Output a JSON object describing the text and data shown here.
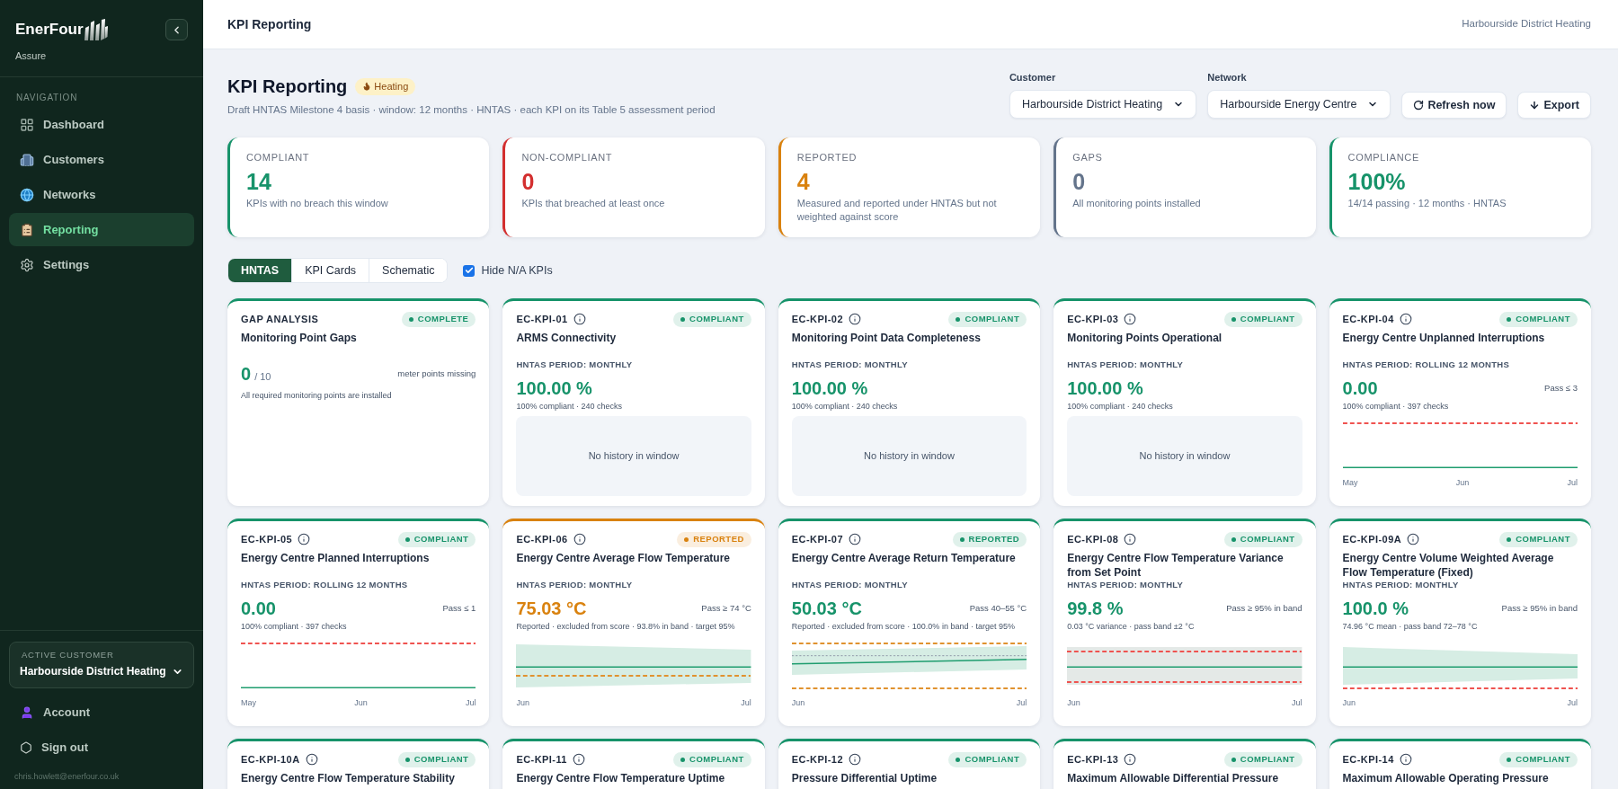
{
  "sidebar": {
    "brand": "EnerFour",
    "product": "Assure",
    "nav_heading": "NAVIGATION",
    "nav_items": [
      {
        "label": "Dashboard",
        "kind": "dashboard",
        "selected": false
      },
      {
        "label": "Customers",
        "kind": "customers",
        "selected": false
      },
      {
        "label": "Networks",
        "kind": "networks",
        "selected": false
      },
      {
        "label": "Reporting",
        "kind": "reporting",
        "selected": true
      },
      {
        "label": "Settings",
        "kind": "settings",
        "selected": false
      }
    ],
    "active_customer": {
      "label": "ACTIVE CUSTOMER",
      "value": "Harbourside District Heating"
    },
    "user_items": [
      {
        "label": "Account",
        "kind": "account"
      },
      {
        "label": "Sign out",
        "kind": "sign_out"
      }
    ],
    "user_email": "chris.howlett@enerfour.co.uk"
  },
  "header": {
    "title": "KPI Reporting",
    "context": "Harbourside District Heating"
  },
  "page": {
    "title": "KPI Reporting",
    "tag": "Heating",
    "subtitle": "Draft HNTAS Milestone 4 basis · window: 12 months · HNTAS · each KPI on its Table 5 assessment period"
  },
  "filters": [
    {
      "label": "Customer",
      "value": "Harbourside District Heating"
    },
    {
      "label": "Network",
      "value": "Harbourside Energy Centre"
    }
  ],
  "actions": [
    {
      "label": "Refresh now",
      "kind": "refresh"
    },
    {
      "label": "Export",
      "kind": "export"
    }
  ],
  "summary_cards": [
    {
      "label": "COMPLIANT",
      "value": "14",
      "description": "KPIs with no breach this window",
      "color": "#17936a"
    },
    {
      "label": "NON-COMPLIANT",
      "value": "0",
      "description": "KPIs that breached at least once",
      "color": "#d32f2f"
    },
    {
      "label": "REPORTED",
      "value": "4",
      "description": "Measured and reported under HNTAS but not weighted against score",
      "color": "#d9820f"
    },
    {
      "label": "GAPS",
      "value": "0",
      "description": "All monitoring points installed",
      "color": "#64748b"
    },
    {
      "label": "COMPLIANCE",
      "value": "100%",
      "description": "14/14 passing · 12 months · HNTAS",
      "color": "#17936a"
    }
  ],
  "view_tabs": [
    {
      "label": "HNTAS",
      "selected": true
    },
    {
      "label": "KPI Cards",
      "selected": false
    },
    {
      "label": "Schematic",
      "selected": false
    }
  ],
  "hide_na": {
    "label": "Hide N/A KPIs",
    "checked": true
  },
  "kpi_cards": [
    {
      "kind": "gap",
      "code": "GAP ANALYSIS",
      "badge": "COMPLETE",
      "color": "#17936a",
      "title": "Monitoring Point Gaps",
      "value": "0",
      "value_total": "/ 10",
      "note": "meter points missing",
      "detail": "All required monitoring points are installed"
    },
    {
      "kind": "kpi",
      "code": "EC-KPI-01",
      "badge": "COMPLIANT",
      "color": "#17936a",
      "title": "ARMS Connectivity",
      "period": "HNTAS PERIOD: MONTHLY",
      "value": "100.00 %",
      "detail": "100% compliant · 240 checks",
      "chart": {
        "kind": "empty",
        "message": "No history in window"
      }
    },
    {
      "kind": "kpi",
      "code": "EC-KPI-02",
      "badge": "COMPLIANT",
      "color": "#17936a",
      "title": "Monitoring Point Data Completeness",
      "period": "HNTAS PERIOD: MONTHLY",
      "value": "100.00 %",
      "detail": "100% compliant · 240 checks",
      "chart": {
        "kind": "empty",
        "message": "No history in window"
      }
    },
    {
      "kind": "kpi",
      "code": "EC-KPI-03",
      "badge": "COMPLIANT",
      "color": "#17936a",
      "title": "Monitoring Points Operational",
      "period": "HNTAS PERIOD: MONTHLY",
      "value": "100.00 %",
      "detail": "100% compliant · 240 checks",
      "chart": {
        "kind": "empty",
        "message": "No history in window"
      }
    },
    {
      "kind": "kpi",
      "code": "EC-KPI-04",
      "badge": "COMPLIANT",
      "color": "#17936a",
      "title": "Energy Centre Unplanned Interruptions",
      "period": "HNTAS PERIOD: ROLLING 12 MONTHS",
      "value": "0.00",
      "target": "Pass ≤ 3",
      "detail": "100% compliant · 397 checks",
      "chart": {
        "kind": "limit",
        "color": "#ef5350",
        "axis_labels": [
          "May",
          "Jun",
          "Jul"
        ]
      }
    },
    {
      "kind": "kpi",
      "code": "EC-KPI-05",
      "badge": "COMPLIANT",
      "color": "#17936a",
      "title": "Energy Centre Planned Interruptions",
      "period": "HNTAS PERIOD: ROLLING 12 MONTHS",
      "value": "0.00",
      "target": "Pass ≤ 1",
      "detail": "100% compliant · 397 checks",
      "chart": {
        "kind": "limit",
        "color": "#ef5350",
        "axis_labels": [
          "May",
          "Jun",
          "Jul"
        ]
      }
    },
    {
      "kind": "kpi",
      "code": "EC-KPI-06",
      "badge": "REPORTED",
      "color": "#d9820f",
      "title": "Energy Centre Average Flow Temperature",
      "period": "HNTAS PERIOD: MONTHLY",
      "value": "75.03 °C",
      "target": "Pass ≥ 74 °C",
      "detail": "Reported · excluded from score · 93.8% in band · target 95%",
      "chart": {
        "kind": "band_falling",
        "color": "#e0922f",
        "axis_labels": [
          "Jun",
          "Jul"
        ]
      }
    },
    {
      "kind": "kpi",
      "code": "EC-KPI-07",
      "badge": "REPORTED",
      "color": "#17936a",
      "title": "Energy Centre Average Return Temperature",
      "period": "HNTAS PERIOD: MONTHLY",
      "value": "50.03 °C",
      "target": "Pass 40–55 °C",
      "detail": "Reported · excluded from score · 100.0% in band · target 95%",
      "chart": {
        "kind": "band_rising",
        "color": "#e0922f",
        "axis_labels": [
          "Jun",
          "Jul"
        ]
      }
    },
    {
      "kind": "kpi",
      "code": "EC-KPI-08",
      "badge": "COMPLIANT",
      "color": "#17936a",
      "title": "Energy Centre Flow Temperature Variance from Set Point",
      "period": "HNTAS PERIOD: MONTHLY",
      "value": "99.8 %",
      "target": "Pass ≥ 95% in band",
      "detail": "0.03 °C variance · pass band ±2 °C",
      "chart": {
        "kind": "band_flat",
        "color": "#ef5350",
        "axis_labels": [
          "Jun",
          "Jul"
        ]
      }
    },
    {
      "kind": "kpi",
      "code": "EC-KPI-09A",
      "badge": "COMPLIANT",
      "color": "#17936a",
      "title": "Energy Centre Volume Weighted Average Flow Temperature (Fixed)",
      "period": "HNTAS PERIOD: MONTHLY",
      "value": "100.0 %",
      "target": "Pass ≥ 95% in band",
      "detail": "74.96 °C mean · pass band 72–78 °C",
      "chart": {
        "kind": "band_narrowing",
        "color": "#ef5350",
        "axis_labels": [
          "Jun",
          "Jul"
        ]
      }
    },
    {
      "kind": "kpi",
      "code": "EC-KPI-10A",
      "badge": "COMPLIANT",
      "color": "#17936a",
      "title": "Energy Centre Flow Temperature Stability"
    },
    {
      "kind": "kpi",
      "code": "EC-KPI-11",
      "badge": "COMPLIANT",
      "color": "#17936a",
      "title": "Energy Centre Flow Temperature Uptime"
    },
    {
      "kind": "kpi",
      "code": "EC-KPI-12",
      "badge": "COMPLIANT",
      "color": "#17936a",
      "title": "Pressure Differential Uptime"
    },
    {
      "kind": "kpi",
      "code": "EC-KPI-13",
      "badge": "COMPLIANT",
      "color": "#17936a",
      "title": "Maximum Allowable Differential Pressure"
    },
    {
      "kind": "kpi",
      "code": "EC-KPI-14",
      "badge": "COMPLIANT",
      "color": "#17936a",
      "title": "Maximum Allowable Operating Pressure"
    }
  ]
}
